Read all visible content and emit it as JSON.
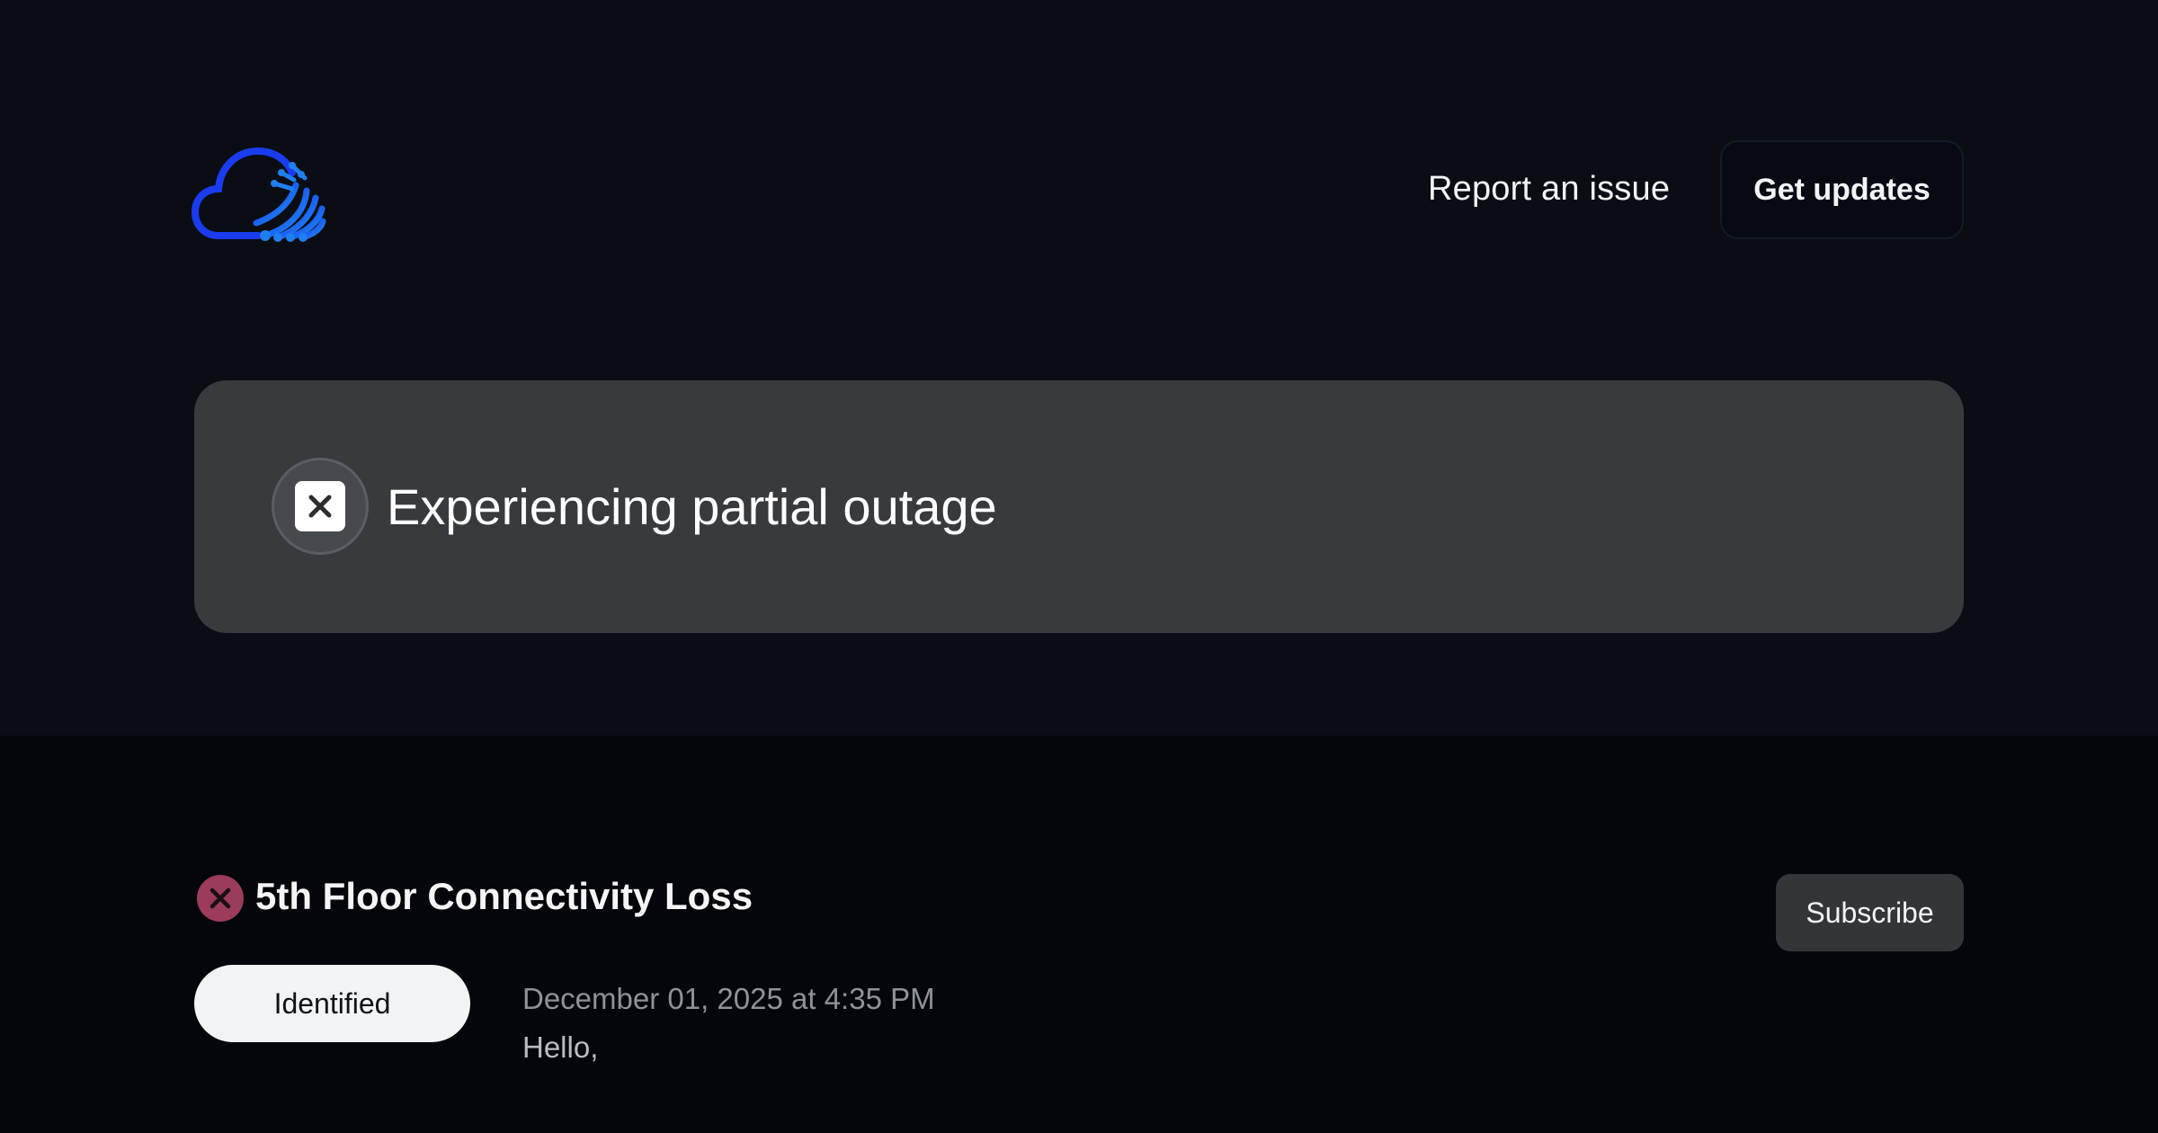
{
  "header": {
    "logo_icon": "cloud-circuit-logo-icon",
    "report_link_label": "Report an issue",
    "get_updates_label": "Get updates"
  },
  "banner": {
    "icon": "close-square-icon",
    "status_text": "Experiencing partial outage",
    "color": "#383b3e"
  },
  "incident": {
    "status_icon": "error-circle-icon",
    "status_icon_color": "#9c3b5b",
    "title": "5th Floor Connectivity Loss",
    "subscribe_label": "Subscribe",
    "update": {
      "status": "Identified",
      "timestamp": "December 01, 2025 at 4:35 PM",
      "body": "Hello,"
    }
  },
  "colors": {
    "page_bg": "#04060b",
    "header_bg": "#0a0d13",
    "logo_blue": "#1a3cf0",
    "logo_cyan": "#1e9bf0"
  }
}
